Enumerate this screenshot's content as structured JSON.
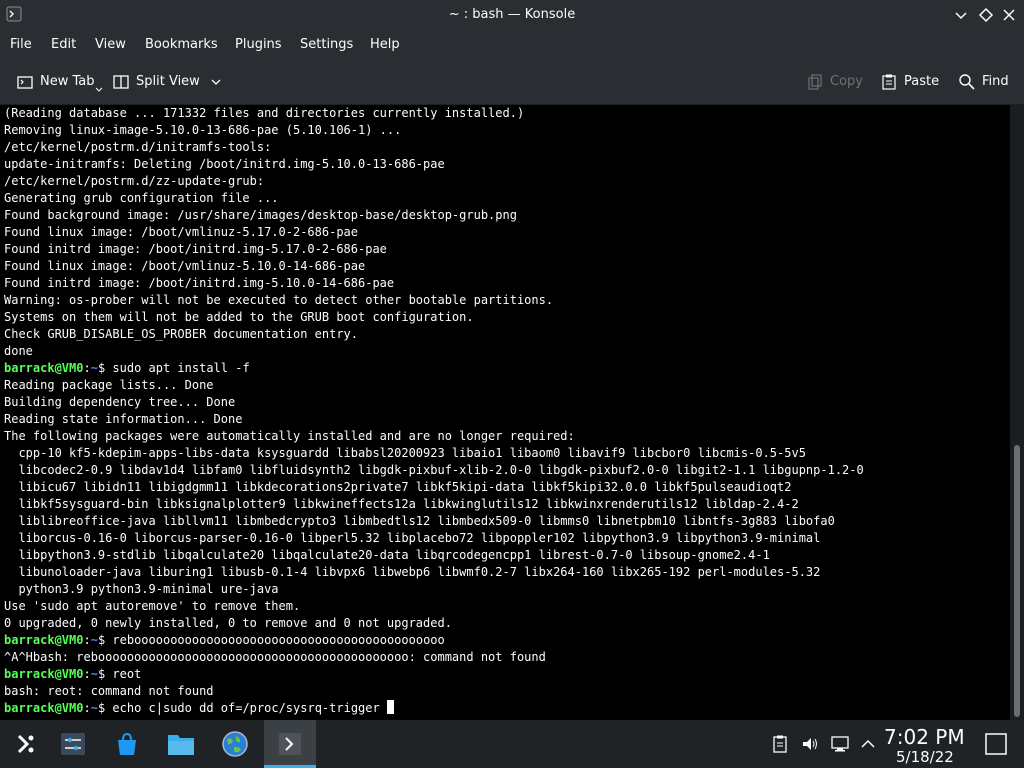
{
  "window": {
    "title": "~ : bash — Konsole",
    "app_icon": "konsole-icon",
    "controls": [
      "minimize-icon",
      "maximize-icon",
      "close-icon"
    ]
  },
  "menubar": {
    "items": [
      "File",
      "Edit",
      "View",
      "Bookmarks",
      "Plugins",
      "Settings",
      "Help"
    ]
  },
  "toolbar": {
    "new_tab": "New Tab",
    "split_view": "Split View",
    "copy": "Copy",
    "paste": "Paste",
    "find": "Find"
  },
  "terminal": {
    "prompt_user": "barrack@VM0",
    "prompt_path": "~",
    "prompt_symbol": "$",
    "lines": [
      {
        "text": "(Reading database ... 171332 files and directories currently installed.)"
      },
      {
        "text": "Removing linux-image-5.10.0-13-686-pae (5.10.106-1) ..."
      },
      {
        "text": "/etc/kernel/postrm.d/initramfs-tools:"
      },
      {
        "text": "update-initramfs: Deleting /boot/initrd.img-5.10.0-13-686-pae"
      },
      {
        "text": "/etc/kernel/postrm.d/zz-update-grub:"
      },
      {
        "text": "Generating grub configuration file ..."
      },
      {
        "text": "Found background image: /usr/share/images/desktop-base/desktop-grub.png"
      },
      {
        "text": "Found linux image: /boot/vmlinuz-5.17.0-2-686-pae"
      },
      {
        "text": "Found initrd image: /boot/initrd.img-5.17.0-2-686-pae"
      },
      {
        "text": "Found linux image: /boot/vmlinuz-5.10.0-14-686-pae"
      },
      {
        "text": "Found initrd image: /boot/initrd.img-5.10.0-14-686-pae"
      },
      {
        "text": "Warning: os-prober will not be executed to detect other bootable partitions."
      },
      {
        "text": "Systems on them will not be added to the GRUB boot configuration."
      },
      {
        "text": "Check GRUB_DISABLE_OS_PROBER documentation entry."
      },
      {
        "text": "done"
      },
      {
        "prompt": true,
        "text": " sudo apt install -f"
      },
      {
        "text": "Reading package lists... Done"
      },
      {
        "text": "Building dependency tree... Done"
      },
      {
        "text": "Reading state information... Done"
      },
      {
        "text": "The following packages were automatically installed and are no longer required:"
      },
      {
        "text": "  cpp-10 kf5-kdepim-apps-libs-data ksysguardd libabsl20200923 libaio1 libaom0 libavif9 libcbor0 libcmis-0.5-5v5"
      },
      {
        "text": "  libcodec2-0.9 libdav1d4 libfam0 libfluidsynth2 libgdk-pixbuf-xlib-2.0-0 libgdk-pixbuf2.0-0 libgit2-1.1 libgupnp-1.2-0"
      },
      {
        "text": "  libicu67 libidn11 libigdgmm11 libkdecorations2private7 libkf5kipi-data libkf5kipi32.0.0 libkf5pulseaudioqt2"
      },
      {
        "text": "  libkf5sysguard-bin libksignalplotter9 libkwineffects12a libkwinglutils12 libkwinxrenderutils12 libldap-2.4-2"
      },
      {
        "text": "  liblibreoffice-java libllvm11 libmbedcrypto3 libmbedtls12 libmbedx509-0 libmms0 libnetpbm10 libntfs-3g883 libofa0"
      },
      {
        "text": "  liborcus-0.16-0 liborcus-parser-0.16-0 libperl5.32 libplacebo72 libpoppler102 libpython3.9 libpython3.9-minimal"
      },
      {
        "text": "  libpython3.9-stdlib libqalculate20 libqalculate20-data libqrcodegencpp1 librest-0.7-0 libsoup-gnome2.4-1"
      },
      {
        "text": "  libunoloader-java liburing1 libusb-0.1-4 libvpx6 libwebp6 libwmf0.2-7 libx264-160 libx265-192 perl-modules-5.32"
      },
      {
        "text": "  python3.9 python3.9-minimal ure-java"
      },
      {
        "text": "Use 'sudo apt autoremove' to remove them."
      },
      {
        "text": "0 upgraded, 0 newly installed, 0 to remove and 0 not upgraded."
      },
      {
        "prompt": true,
        "text": " rebooooooooooooooooooooooooooooooooooooooooooo"
      },
      {
        "text": "^A^Hbash: rebooooooooooooooooooooooooooooooooooooooooooo: command not found"
      },
      {
        "prompt": true,
        "text": " reot"
      },
      {
        "text": "bash: reot: command not found"
      },
      {
        "prompt": true,
        "text": " echo c|sudo dd of=/proc/sysrq-trigger ",
        "cursor": true
      }
    ]
  },
  "taskbar": {
    "launchers": [
      {
        "name": "application-launcher-icon"
      },
      {
        "name": "system-settings-icon"
      },
      {
        "name": "discover-store-icon"
      },
      {
        "name": "file-manager-icon"
      },
      {
        "name": "web-browser-icon"
      },
      {
        "name": "konsole-task-icon",
        "active": true
      }
    ],
    "tray_icons": [
      "clipboard-icon",
      "volume-icon",
      "network-icon",
      "expand-tray-icon"
    ],
    "clock": {
      "time": "7:02 PM",
      "date": "5/18/22"
    },
    "show_desktop": "show-desktop-icon"
  },
  "colors": {
    "accent": "#3daee9",
    "prompt_user": "#55ff55",
    "prompt_path": "#5c7cfa",
    "terminal_bg": "#000000",
    "chrome_bg": "#2a2e32"
  }
}
